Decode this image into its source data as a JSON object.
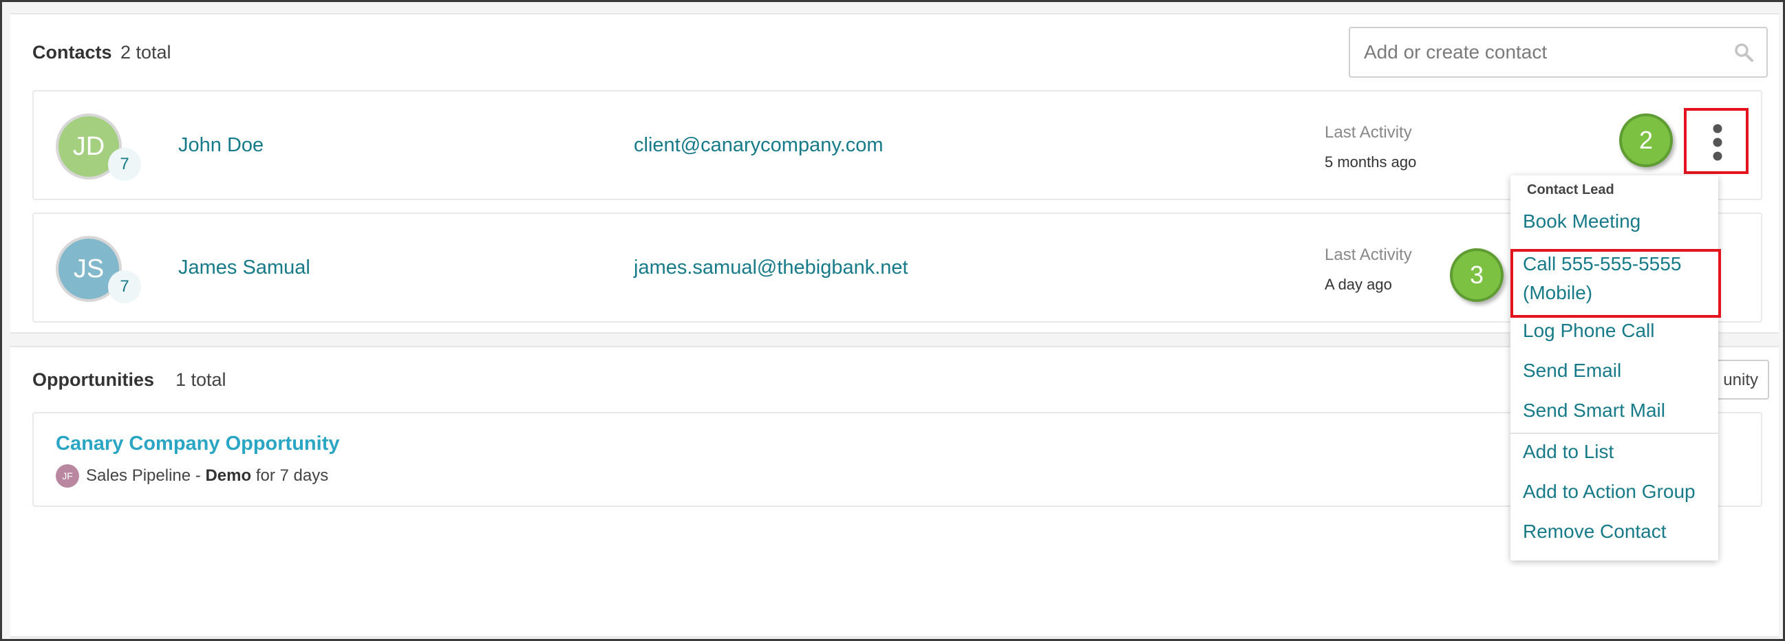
{
  "contacts": {
    "title": "Contacts",
    "count_text": "2 total",
    "search_placeholder": "Add or create contact",
    "rows": [
      {
        "initials": "JD",
        "badge": "7",
        "name": "John Doe",
        "email": "client@canarycompany.com",
        "activity_label": "Last Activity",
        "activity_value": "5 months ago",
        "avatar_color": "#a3cf7f"
      },
      {
        "initials": "JS",
        "badge": "7",
        "name": "James Samual",
        "email": "james.samual@thebigbank.net",
        "activity_label": "Last Activity",
        "activity_value": "A day ago",
        "avatar_color": "#82b8cc"
      }
    ]
  },
  "steps": {
    "kebab": "2",
    "call": "3"
  },
  "menu": {
    "header": "Contact Lead",
    "items": [
      "Book Meeting",
      "Call 555-555-5555",
      "(Mobile)",
      "Log Phone Call",
      "Send Email",
      "Send Smart Mail",
      "Add to List",
      "Add to Action Group",
      "Remove Contact"
    ]
  },
  "opportunities": {
    "title": "Opportunities",
    "count_text": "1 total",
    "new_button_label": "unity",
    "rows": [
      {
        "title": "Canary Company Opportunity",
        "avatar_initials": "JF",
        "pipeline": "Sales Pipeline",
        "separator": "-",
        "stage": "Demo",
        "duration": "for 7 days"
      }
    ]
  },
  "colors": {
    "accent": "#177a88",
    "link": "#2aa6c4",
    "highlight": "#e4141e",
    "step_badge": "#7cc142"
  },
  "icons": {
    "search": "search-icon",
    "menu": "kebab-menu-icon"
  }
}
